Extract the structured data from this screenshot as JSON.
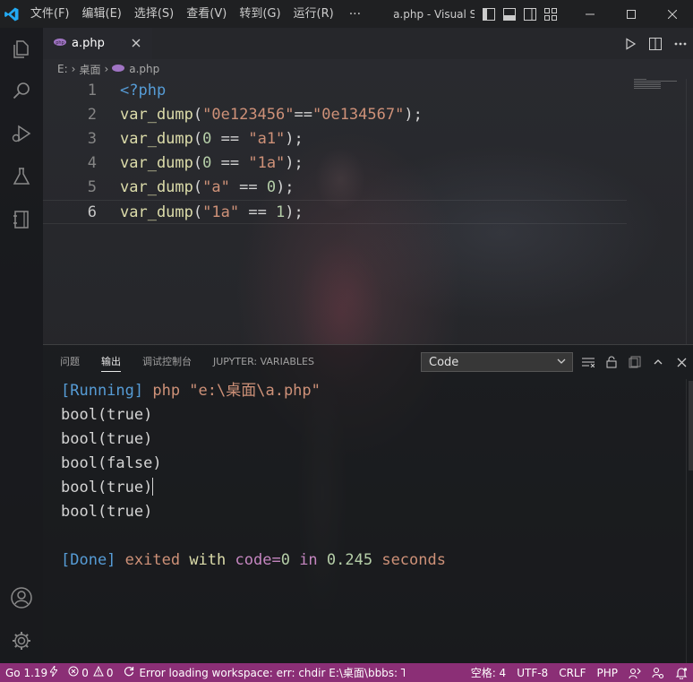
{
  "titlebar": {
    "menu": [
      "文件(F)",
      "编辑(E)",
      "选择(S)",
      "查看(V)",
      "转到(G)",
      "运行(R)"
    ],
    "more": "···",
    "window_title": "a.php - Visual Studi..."
  },
  "tab": {
    "label": "a.php"
  },
  "breadcrumb": {
    "drive": "E:",
    "folder": "桌面",
    "file": "a.php"
  },
  "editor": {
    "line_numbers": [
      "1",
      "2",
      "3",
      "4",
      "5",
      "6"
    ],
    "lines": [
      [
        {
          "t": "<?php",
          "c": "kw"
        }
      ],
      [
        {
          "t": "var_dump",
          "c": "fn"
        },
        {
          "t": "(",
          "c": "pn"
        },
        {
          "t": "\"0e123456\"",
          "c": "st"
        },
        {
          "t": "==",
          "c": "pn"
        },
        {
          "t": "\"0e134567\"",
          "c": "st"
        },
        {
          "t": ");",
          "c": "pn"
        }
      ],
      [
        {
          "t": "var_dump",
          "c": "fn"
        },
        {
          "t": "(",
          "c": "pn"
        },
        {
          "t": "0",
          "c": "nm"
        },
        {
          "t": " == ",
          "c": "pn"
        },
        {
          "t": "\"a1\"",
          "c": "st"
        },
        {
          "t": ");",
          "c": "pn"
        }
      ],
      [
        {
          "t": "var_dump",
          "c": "fn"
        },
        {
          "t": "(",
          "c": "pn"
        },
        {
          "t": "0",
          "c": "nm"
        },
        {
          "t": " == ",
          "c": "pn"
        },
        {
          "t": "\"1a\"",
          "c": "st"
        },
        {
          "t": ");",
          "c": "pn"
        }
      ],
      [
        {
          "t": "var_dump",
          "c": "fn"
        },
        {
          "t": "(",
          "c": "pn"
        },
        {
          "t": "\"a\"",
          "c": "st"
        },
        {
          "t": " == ",
          "c": "pn"
        },
        {
          "t": "0",
          "c": "nm"
        },
        {
          "t": ");",
          "c": "pn"
        }
      ],
      [
        {
          "t": "var_dump",
          "c": "fn"
        },
        {
          "t": "(",
          "c": "pn"
        },
        {
          "t": "\"1a\"",
          "c": "st"
        },
        {
          "t": " == ",
          "c": "pn"
        },
        {
          "t": "1",
          "c": "nm"
        },
        {
          "t": ");",
          "c": "pn"
        }
      ]
    ]
  },
  "panel": {
    "tabs": [
      "问题",
      "输出",
      "调试控制台",
      "JUPYTER: VARIABLES"
    ],
    "active_tab": "输出",
    "output_channel": "Code"
  },
  "output": {
    "running_tag": "[Running]",
    "running_cmd": " php \"e:\\桌面\\a.php\"",
    "results": [
      "bool(true)",
      "bool(true)",
      "bool(false)",
      "bool(true)",
      "bool(true)"
    ],
    "done_tag": "[Done]",
    "done_exited": " exited ",
    "done_with": "with",
    "done_code": " code",
    "done_eq": "=",
    "done_zero": "0",
    "done_in": " in ",
    "done_time": "0.245",
    "done_seconds": " seconds"
  },
  "statusbar": {
    "go_version": "Go 1.19",
    "errors": "0",
    "warnings": "0",
    "message": "Error loading workspace: err: chdir E:\\桌面\\bbbs: The",
    "spaces": "空格: 4",
    "encoding": "UTF-8",
    "eol": "CRLF",
    "language": "PHP"
  },
  "colors": {
    "statusbar_bg": "#8b2f76",
    "vscode_blue": "#23a9f2",
    "php_purple": "#a074c4"
  }
}
